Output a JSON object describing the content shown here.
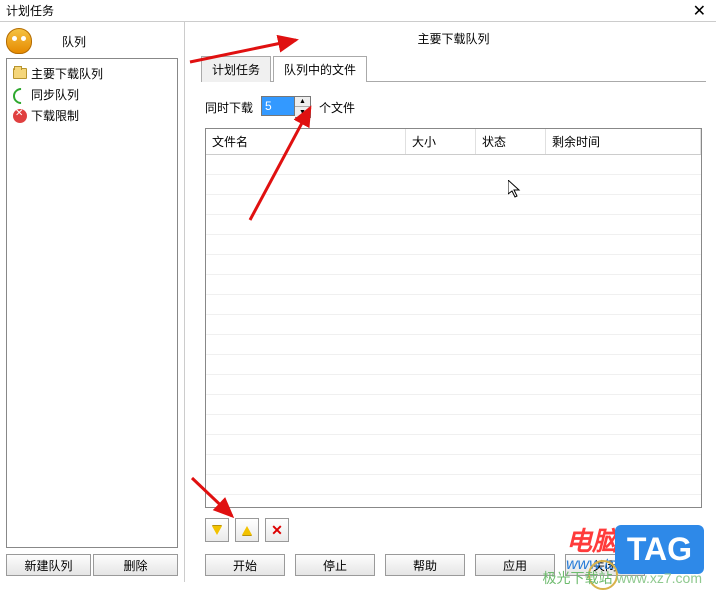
{
  "window": {
    "title": "计划任务"
  },
  "sidebar": {
    "label": "队列",
    "items": [
      {
        "label": "主要下载队列"
      },
      {
        "label": "同步队列"
      },
      {
        "label": "下载限制"
      }
    ],
    "buttons": {
      "new_queue": "新建队列",
      "delete": "删除"
    }
  },
  "main": {
    "title": "主要下载队列",
    "tabs": [
      {
        "label": "计划任务"
      },
      {
        "label": "队列中的文件"
      }
    ],
    "concurrent": {
      "prefix": "同时下载",
      "value": "5",
      "suffix": "个文件"
    },
    "table": {
      "columns": {
        "name": "文件名",
        "size": "大小",
        "status": "状态",
        "time": "剩余时间"
      }
    },
    "bottom": {
      "start": "开始",
      "stop": "停止",
      "help": "帮助",
      "apply": "应用",
      "close": "关闭"
    }
  },
  "watermark": {
    "brand": "电脑技术网",
    "url": "www.tagxp.com",
    "tag": "TAG",
    "site_name": "极光下载站",
    "site_url": "www.xz7.com"
  }
}
